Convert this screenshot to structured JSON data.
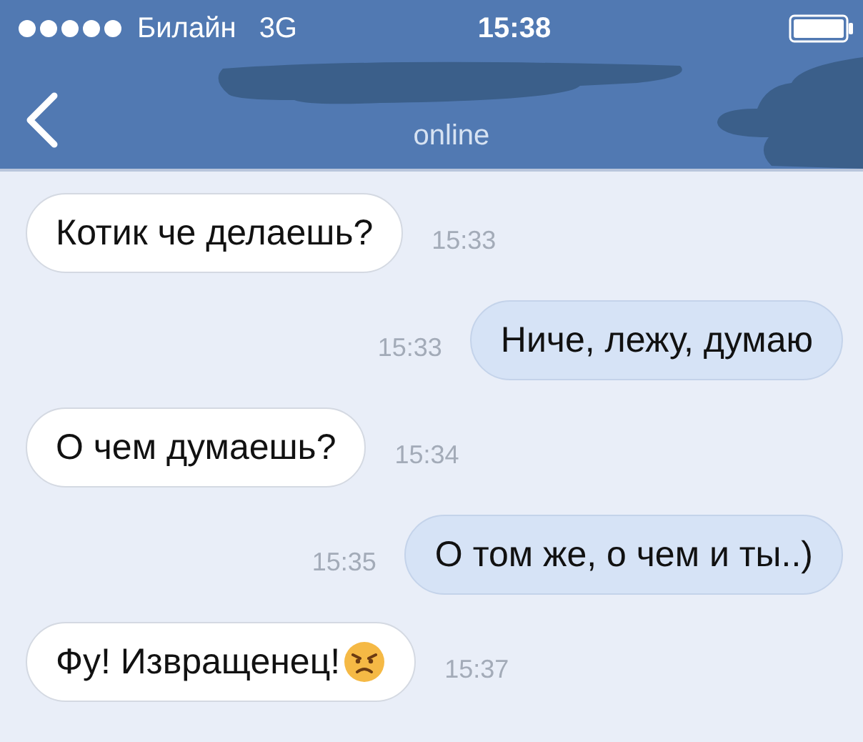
{
  "status_bar": {
    "carrier": "Билайн",
    "network": "3G",
    "time": "15:38"
  },
  "nav_bar": {
    "subtitle": "online"
  },
  "messages": [
    {
      "kind": "incoming",
      "text": "Котик че делаешь?",
      "time": "15:33"
    },
    {
      "kind": "outgoing",
      "text": "Ниче, лежу, думаю",
      "time": "15:33"
    },
    {
      "kind": "incoming",
      "text": "О чем думаешь?",
      "time": "15:34"
    },
    {
      "kind": "outgoing",
      "text": "О том же, о чем и ты..)",
      "time": "15:35"
    },
    {
      "kind": "incoming",
      "text": "Фу! Извращенец!",
      "emoji": true,
      "time": "15:37"
    }
  ]
}
